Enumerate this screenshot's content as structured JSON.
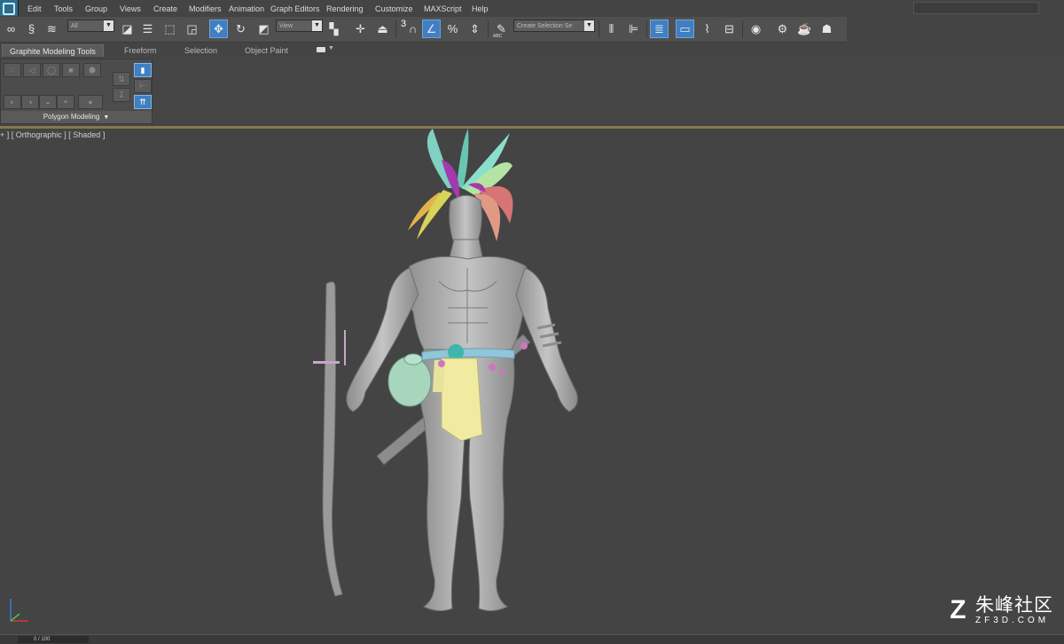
{
  "menu": [
    "Edit",
    "Tools",
    "Group",
    "Views",
    "Create",
    "Modifiers",
    "Animation",
    "Graph Editors",
    "Rendering",
    "Customize",
    "MAXScript",
    "Help"
  ],
  "toolbar": {
    "filter_value": "All",
    "refcoord_value": "View",
    "snap_number": "3",
    "selection_set_placeholder": "Create Selection Se",
    "abc_label": "ABC"
  },
  "ribbon": {
    "tabs": [
      "Graphite Modeling Tools",
      "Freeform",
      "Selection",
      "Object Paint"
    ],
    "group_label": "Polygon Modeling"
  },
  "viewport": {
    "label": "+ ] [ Orthographic ] [ Shaded ]"
  },
  "watermark": {
    "logo": "Z",
    "main": "朱峰社区",
    "sub": "ZF3D.COM"
  },
  "status": {
    "frame": "0 / 100"
  },
  "icons": [
    "link-icon",
    "unlink-icon",
    "bind-spacewarp-icon",
    "select-object-icon",
    "select-by-name-icon",
    "rect-region-icon",
    "window-crossing-icon",
    "move-icon",
    "rotate-icon",
    "scale-icon",
    "pivot-icon",
    "manipulate-icon",
    "snap-icon",
    "angle-snap-icon",
    "percent-snap-icon",
    "spinner-snap-icon",
    "edit-named-sel-icon",
    "mirror-icon",
    "align-icon",
    "layer-manager-icon",
    "graphite-toggle-icon",
    "curve-editor-icon",
    "schematic-view-icon",
    "material-editor-icon",
    "render-setup-icon",
    "rendered-frame-icon",
    "render-icon"
  ],
  "colors": {
    "accent_blue": "#3f7fc2",
    "viewport_bg": "#444444",
    "active_border": "#8a7a3c"
  }
}
